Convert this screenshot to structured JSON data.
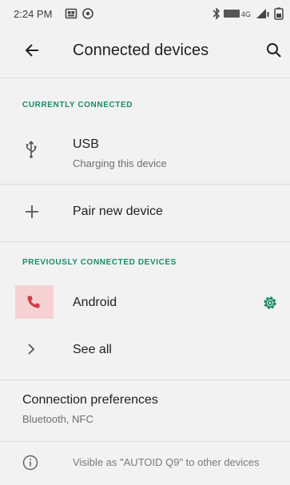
{
  "status_bar": {
    "time": "2:24 PM",
    "left_icons": [
      "gallery-icon",
      "sync-icon"
    ],
    "right_icons": [
      "bluetooth-icon",
      "volte-4g-icon",
      "signal-icon",
      "battery-icon"
    ],
    "network_label": "4G"
  },
  "app_bar": {
    "title": "Connected devices",
    "back_icon": "arrow-back-icon",
    "search_icon": "search-icon"
  },
  "sections": {
    "currently_connected": "CURRENTLY CONNECTED",
    "previously_connected": "PREVIOUSLY CONNECTED DEVICES"
  },
  "usb": {
    "title": "USB",
    "subtitle": "Charging this device",
    "icon": "usb-icon"
  },
  "pair": {
    "label": "Pair new device",
    "icon": "plus-icon"
  },
  "previous_device": {
    "name": "Android",
    "icon": "phone-icon",
    "settings_icon": "gear-icon"
  },
  "see_all": {
    "label": "See all",
    "icon": "chevron-right-icon"
  },
  "preferences": {
    "title": "Connection preferences",
    "subtitle": "Bluetooth, NFC"
  },
  "footer": {
    "text": "Visible as \"AUTOID Q9\" to other devices",
    "icon": "info-icon"
  },
  "colors": {
    "accent": "#1a8a6b",
    "background": "#f2f2f2",
    "phone_icon_bg": "#f5d1d4",
    "phone_icon": "#d33b46"
  }
}
